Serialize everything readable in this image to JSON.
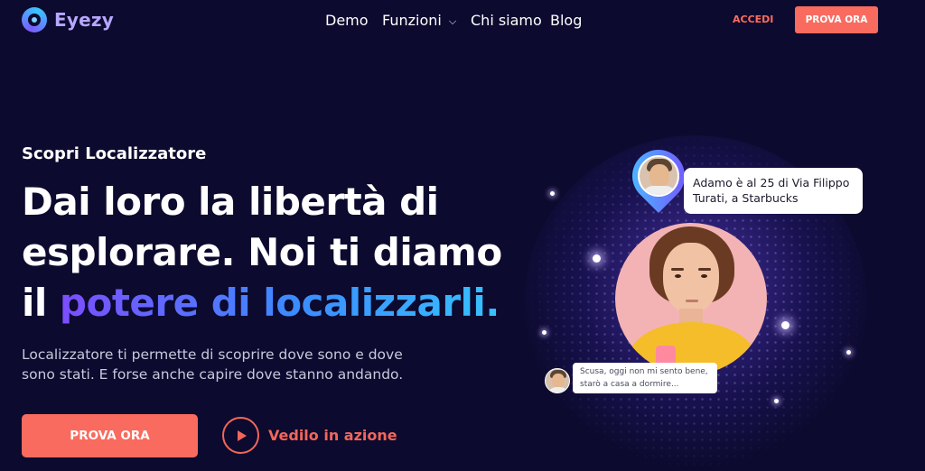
{
  "nav": {
    "logo_text": "Eyezy",
    "links": [
      "Demo",
      "Funzioni",
      "Chi siamo",
      "Blog"
    ],
    "login": "ACCEDI",
    "cta": "PROVA ORA"
  },
  "hero": {
    "eyebrow": "Scopri Localizzatore",
    "headline_line1": "Dai loro la libertà di",
    "headline_line2": "esplorare. Noi ti diamo",
    "headline_line3_plain": "il ",
    "headline_line3_accent": "potere di localizzarli.",
    "description": "Localizzatore ti permette di scoprire dove sono e dove sono stati. E forse anche capire dove stanno andando.",
    "cta_primary": "PROVA ORA",
    "cta_video": "Vedilo in azione"
  },
  "visual": {
    "location_bubble": "Adamo è al 25 di Via Filippo Turati, a Starbucks",
    "message_bubble": "Scusa, oggi non mi sento bene, starò a casa a dormire..."
  },
  "colors": {
    "background": "#0c0a2e",
    "accent_coral": "#f86b5e",
    "accent_gradient_start": "#7d4dff",
    "accent_gradient_end": "#38c2ff"
  }
}
